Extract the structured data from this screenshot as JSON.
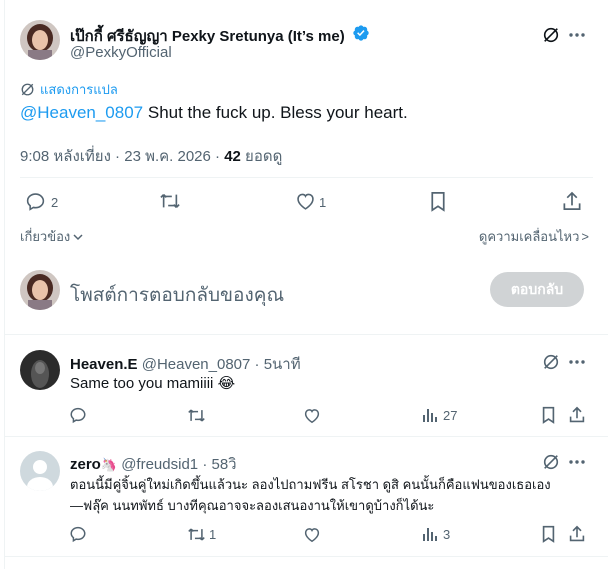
{
  "main_post": {
    "display_name": "เป๊กกี้ ศรีธัญญา Pexky Sretunya (It’s me)",
    "handle": "@PexkyOfficial",
    "translate_label": "แสดงการแปล",
    "mention": "@Heaven_0807",
    "text": " Shut the fuck up. Bless your heart.",
    "time": "9:08 หลังเที่ยง · 23 พ.ค. 2026 · ",
    "views_count": "42",
    "views_label": " ยอดดู",
    "reply_count": "2",
    "like_count": "1",
    "related_label": "เกี่ยวข้อง",
    "more_label": "ดูความเคลื่อนไหว",
    "more_label_end": ">"
  },
  "composer": {
    "placeholder": "โพสต์การตอบกลับของคุณ",
    "button": "ตอบกลับ"
  },
  "replies": [
    {
      "display_name": "Heaven.E",
      "handle": "@Heaven_0807",
      "time": "· 5นาที",
      "text": "Same too you mamiiii",
      "emoji": "😂",
      "views": "27"
    },
    {
      "display_name": "zero",
      "badge_emoji": "🦄",
      "handle": "@freudsid1",
      "time": "· 58วิ",
      "text_line1": "ตอนนี้มีคู่จิ้นคู่ใหม่เกิดขึ้นแล้วนะ ลองไปถามฟรีน สโรชา ดูสิ คนนั้นก็คือแฟนของเธอเอง",
      "text_line2": "—ฟลุ๊ค นนทพัทธ์ บางทีคุณอาจจะลองเสนองานให้เขาดูบ้างก็ได้นะ",
      "retweets": "1",
      "views": "3"
    }
  ],
  "colors": {
    "accent": "#1d9bf0",
    "text": "#0f1419",
    "secondary": "#536471",
    "button_disabled": "#d0d3d5"
  }
}
